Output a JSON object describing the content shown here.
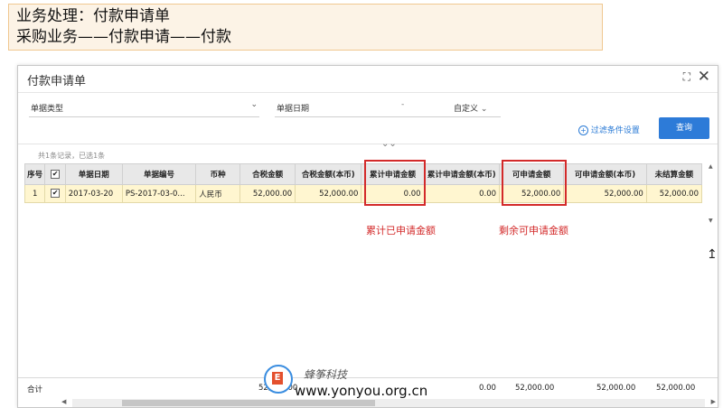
{
  "banner": {
    "line1": "业务处理：付款申请单",
    "line2": "采购业务——付款申请——付款"
  },
  "dialog": {
    "title": "付款申请单",
    "maximize_icon": "maximize-icon",
    "close_icon": "close-icon",
    "close_symbol": "✕",
    "maximize_symbol": "⛶"
  },
  "filters": {
    "doc_type_label": "单据类型",
    "doc_date_label": "单据日期",
    "date_separator": "-",
    "custom_label": "自定义",
    "filter_settings_link": "过滤条件设置",
    "query_button": "查询"
  },
  "records": {
    "summary": "共1条记录，已选1条"
  },
  "table": {
    "columns": [
      "序号",
      "",
      "单据日期",
      "单据编号",
      "币种",
      "合税金额",
      "合税金额(本币)",
      "累计申请金额",
      "累计申请金额(本币)",
      "可申请金额",
      "可申请金额(本币)",
      "未结算金额"
    ],
    "rows": [
      {
        "index": "1",
        "checked": "✔",
        "date": "2017-03-20",
        "number": "PS-2017-03-0...",
        "currency": "人民币",
        "tax_amount": "52,000.00",
        "tax_amount_local": "52,000.00",
        "cum_applied": "0.00",
        "cum_applied_local": "0.00",
        "available": "52,000.00",
        "available_local": "52,000.00",
        "unsettled": "52,000.00"
      }
    ],
    "header_check": "✔"
  },
  "annotations": {
    "cum_applied_note": "累计已申请金额",
    "remaining_note": "剩余可申请金额",
    "highlight_color": "#d32a2a"
  },
  "totals": {
    "label": "合计",
    "tax_amount": "52,000.00",
    "cum_applied_local": "0.00",
    "available": "52,000.00",
    "available_local": "52,000.00",
    "unsettled": "52,000.00"
  },
  "watermark": {
    "brand": "蜂筝科技",
    "url": "www.yonyou.org.cn"
  },
  "colors": {
    "accent": "#2d7bd8",
    "row_highlight": "#fff6d0",
    "banner_bg": "#fcf3e6"
  }
}
